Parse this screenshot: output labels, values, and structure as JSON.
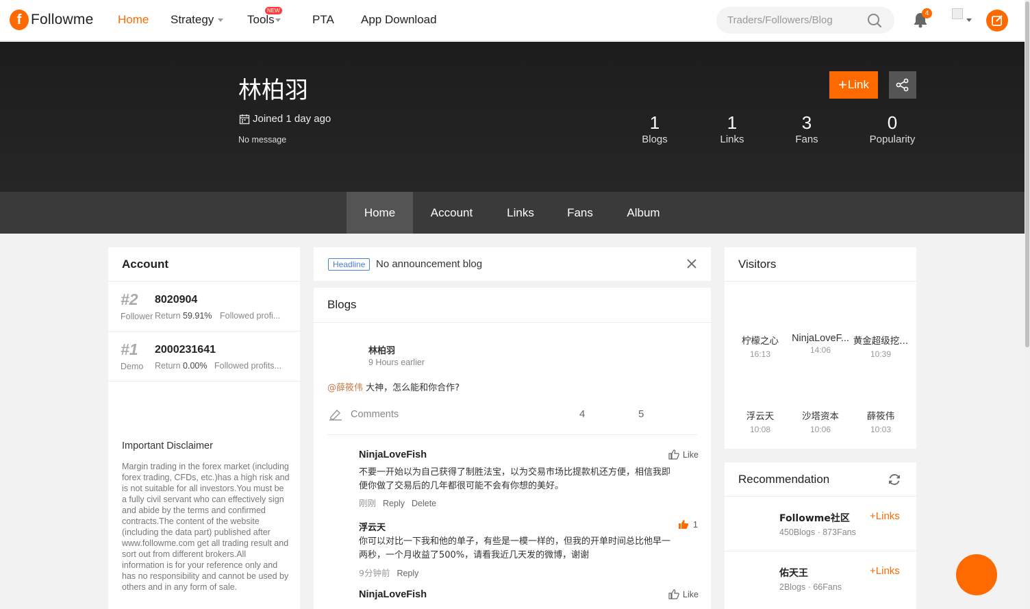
{
  "nav": {
    "logo_mark": "f",
    "logo_text": "Followme",
    "items": [
      {
        "label": "Home"
      },
      {
        "label": "Strategy"
      },
      {
        "label": "Tools",
        "badge": "NEW"
      },
      {
        "label": "PTA"
      },
      {
        "label": "App Download"
      }
    ],
    "search_placeholder": "Traders/Followers/Blog",
    "notification_count": "4",
    "accent": "#ff6a00"
  },
  "profile": {
    "name": "林柏羽",
    "joined": "Joined 1 day ago",
    "message": "No message",
    "link_button": "Link",
    "stats": [
      {
        "value": "1",
        "label": "Blogs"
      },
      {
        "value": "1",
        "label": "Links"
      },
      {
        "value": "3",
        "label": "Fans"
      },
      {
        "value": "0",
        "label": "Popularity"
      }
    ]
  },
  "tabs": [
    "Home",
    "Account",
    "Links",
    "Fans",
    "Album"
  ],
  "account": {
    "title": "Account",
    "items": [
      {
        "rank": "#2",
        "number": "8020904",
        "type": "Follower",
        "return_label": "Return",
        "return_value": "59.91%",
        "followed": "Followed profi..."
      },
      {
        "rank": "#1",
        "number": "2000231641",
        "type": "Demo",
        "return_label": "Return",
        "return_value": "0.00%",
        "followed": "Followed profits..."
      }
    ],
    "disclaimer_title": "Important Disclaimer",
    "disclaimer": "Margin trading in the forex market (including forex trading, CFDs, etc.)has a high risk and is not suitable for all investors.You must be a fully civil servant who can effectively sign and abide by the terms and confirmed contracts.The content of the website (including the data part) published after www.followme.com get all trading result and sort out from different brokers.All information is for your reference only and has no responsibility and cannot be used by others and in any form of sale."
  },
  "announcement": {
    "tag": "Headline",
    "text": "No announcement blog"
  },
  "blogs": {
    "title": "Blogs",
    "post": {
      "author": "林柏羽",
      "time": "9 Hours earlier",
      "mention": "@薛筱伟",
      "content": " 大神，怎么能和你合作?",
      "comments_label": "Comments",
      "count_a": "4",
      "count_b": "5"
    },
    "comments": [
      {
        "author": "NinjaLoveFish",
        "like_label": "Like",
        "line1": "不要一开始以为自己获得了制胜法宝，以为交易市场比提款机还方便，相信我即",
        "line2": "便你做了交易后的几年都很可能不会有你想的美好。",
        "time": "刚刚",
        "reply": "Reply",
        "delete": "Delete"
      },
      {
        "author": "浮云天",
        "like_count": "1",
        "line1": "你可以对比一下我和他的单子，有些是一模一样的，但我的开单时间总比他早一",
        "line2": "两秒，一个月收益了500%，请看我近几天发的微博，谢谢",
        "time": "9分钟前",
        "reply": "Reply"
      },
      {
        "author": "NinjaLoveFish",
        "like_label": "Like"
      }
    ]
  },
  "visitors": {
    "title": "Visitors",
    "items": [
      {
        "name": "柠檬之心",
        "time": "16:13"
      },
      {
        "name": "NinjaLoveF...",
        "time": "14:06"
      },
      {
        "name": "黄金超级挖...",
        "time": "10:39"
      },
      {
        "name": "浮云天",
        "time": "10:08"
      },
      {
        "name": "沙塔资本",
        "time": "10:06"
      },
      {
        "name": "薛筱伟",
        "time": "10:03"
      }
    ]
  },
  "recommendation": {
    "title": "Recommendation",
    "items": [
      {
        "name": "Followme社区",
        "meta": "450Blogs · 873Fans",
        "action": "Links"
      },
      {
        "name": "佑天王",
        "meta": "2Blogs · 66Fans",
        "action": "Links"
      }
    ]
  }
}
